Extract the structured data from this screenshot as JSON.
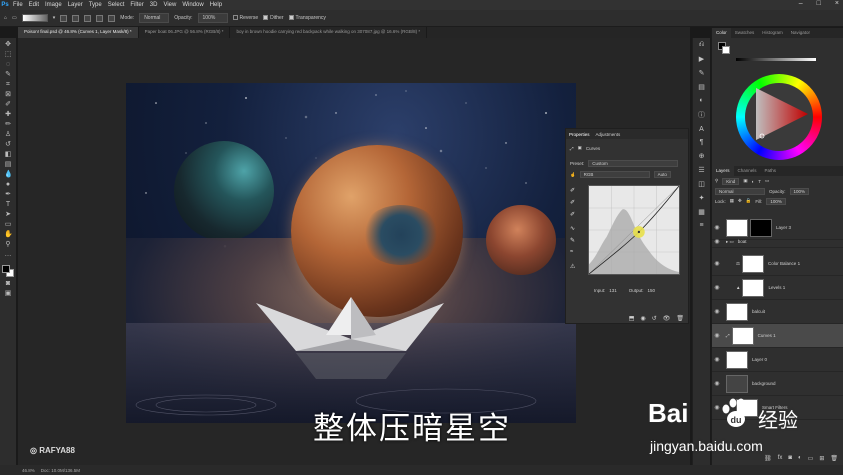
{
  "menu": {
    "app_logo": "Ps",
    "items": [
      "File",
      "Edit",
      "Image",
      "Layer",
      "Type",
      "Select",
      "Filter",
      "3D",
      "View",
      "Window",
      "Help"
    ],
    "window_controls": [
      "–",
      "□",
      "×"
    ]
  },
  "options_bar": {
    "mode_label": "Mode:",
    "mode_value": "Normal",
    "opacity_label": "Opacity:",
    "opacity_value": "100%",
    "reverse_label": "Reverse",
    "dither_label": "Dither",
    "transparency_label": "Transparency"
  },
  "tabs": [
    {
      "label": "Poison! final.psd @ 46.8% (Curves 1, Layer Mask/8) *"
    },
    {
      "label": "Paper boat 06.JPG @ 56.8% (RGB/8) *"
    },
    {
      "label": "boy in brown hoodie carrying red backpack while walking on 307087.jpg @ 16.6% (RGB/8) *"
    }
  ],
  "overlay": {
    "instagram": "RAFYA88",
    "caption": "整体压暗星空",
    "baidu_logo": "Bai",
    "baidu_du": "du",
    "baidu_jingyan": "经验",
    "baidu_url": "jingyan.baidu.com"
  },
  "properties": {
    "tab_properties": "Properties",
    "tab_adjustments": "Adjustments",
    "type_label": "Curves",
    "preset_label": "Preset:",
    "preset_value": "Custom",
    "channel_value": "RGB",
    "auto_label": "Auto",
    "input_label": "Input:",
    "input_value": "131",
    "output_label": "Output:",
    "output_value": "150"
  },
  "color_panel": {
    "tabs": [
      "Color",
      "Swatches",
      "Histogram",
      "Navigator"
    ],
    "accent": "#ff0000"
  },
  "layers_panel": {
    "tabs": [
      "Layers",
      "Channels",
      "Paths"
    ],
    "kind_value": "Kind",
    "blend_value": "Normal",
    "opacity_label": "Opacity:",
    "opacity_value": "100%",
    "lock_label": "Lock:",
    "fill_label": "Fill:",
    "fill_value": "100%",
    "layers": [
      {
        "name": "Layer 3"
      },
      {
        "name": "boat"
      },
      {
        "name": "Color Balance 1"
      },
      {
        "name": "Levels 1"
      },
      {
        "name": "balcuit"
      },
      {
        "name": "Curves 1"
      },
      {
        "name": "Layer 0"
      },
      {
        "name": "background"
      },
      {
        "name": "Smart Filters"
      }
    ]
  },
  "status": {
    "zoom": "46.8%",
    "doc": "Doc: 10.0M/136.5M"
  }
}
